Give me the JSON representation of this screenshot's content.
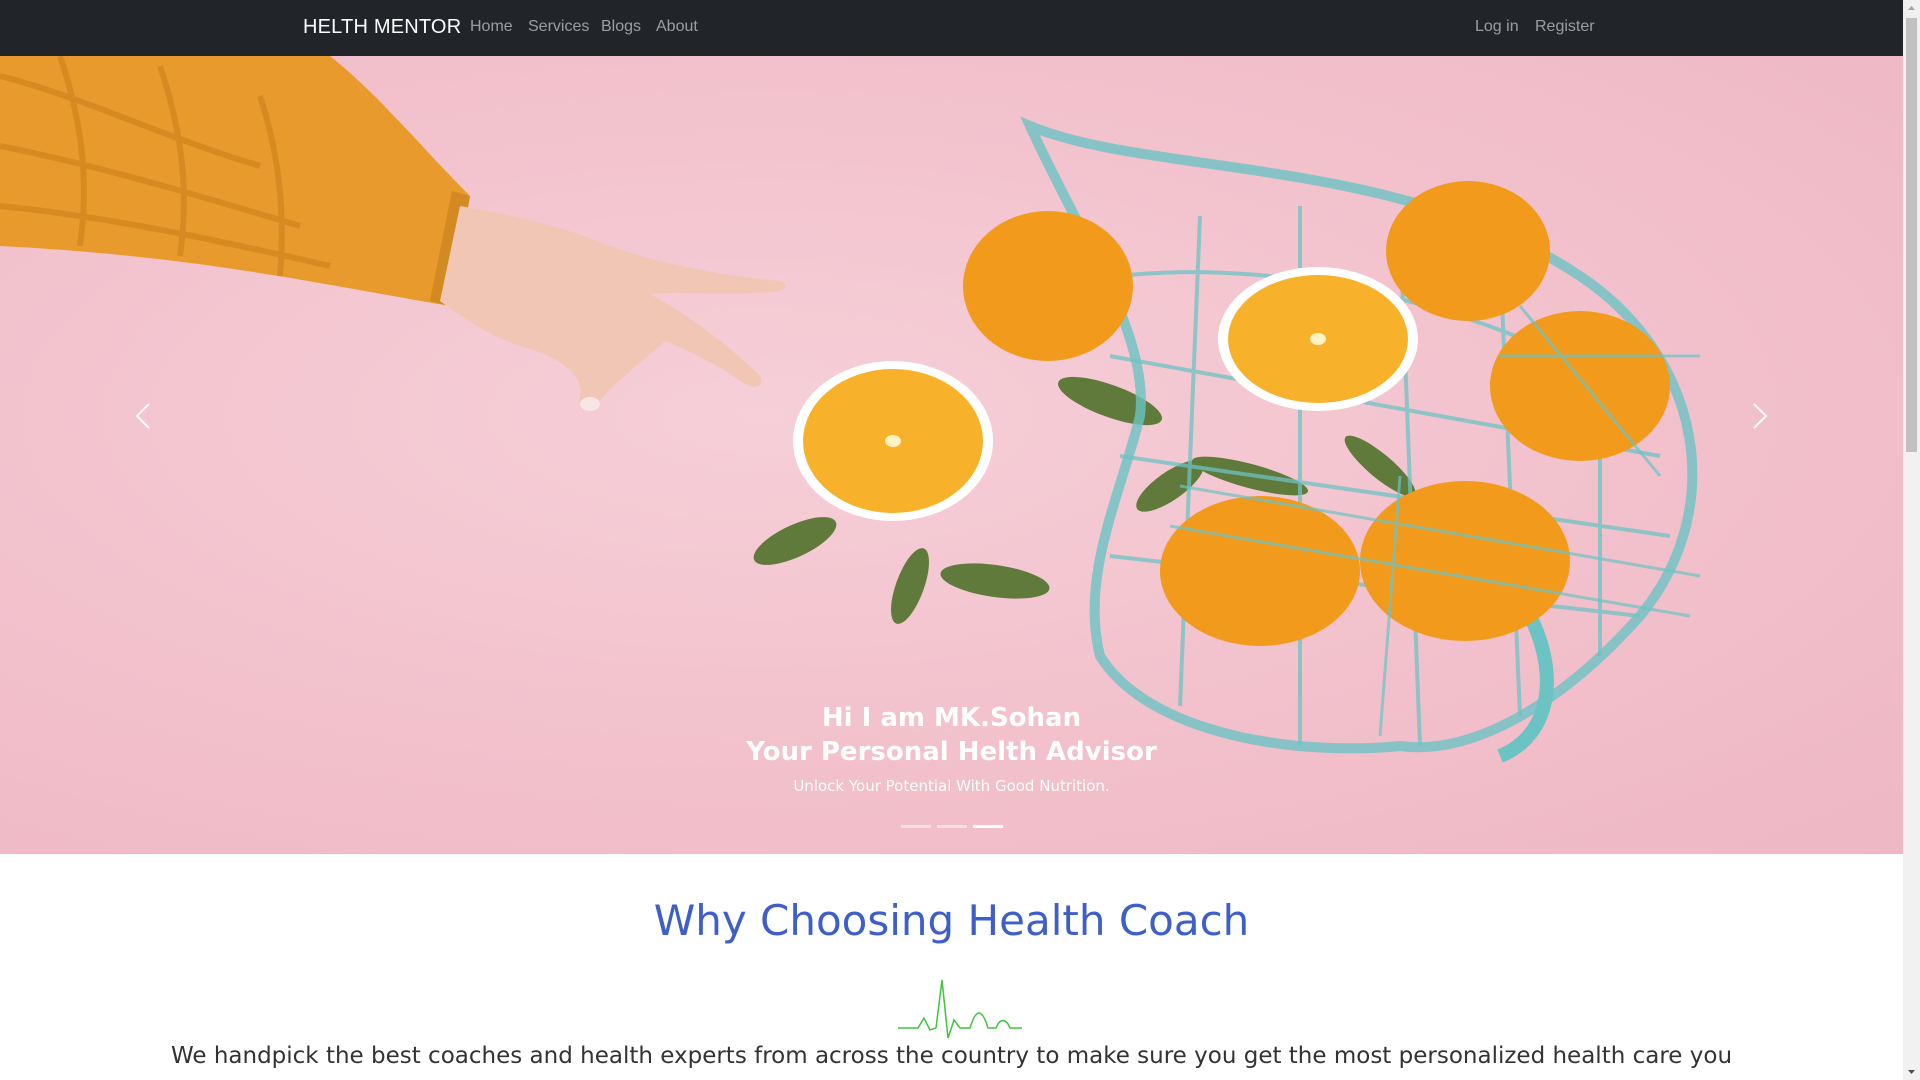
{
  "navbar": {
    "brand": "HELTH MENTOR",
    "links": [
      "Home",
      "Services",
      "Blogs",
      "About"
    ],
    "auth": {
      "login": "Log in",
      "register": "Register"
    }
  },
  "carousel": {
    "title_line1": "Hi I am MK.Sohan",
    "title_line2": "Your Personal Helth Advisor",
    "subtitle": "Unlock Your Potential With Good Nutrition.",
    "slide_count": 3,
    "active_slide": 3,
    "prev_icon": "chevron-left-icon",
    "next_icon": "chevron-right-icon"
  },
  "section": {
    "title": "Why Choosing Health Coach",
    "text": "We handpick the best coaches and health experts from across the country to make sure you get the most personalized health care you",
    "divider_icon": "heartbeat-icon"
  },
  "colors": {
    "navbar_bg": "#212529",
    "accent_blue": "#3f5fc8",
    "pulse_green": "#3ec43e",
    "hero_pink": "#f2c1cc"
  }
}
